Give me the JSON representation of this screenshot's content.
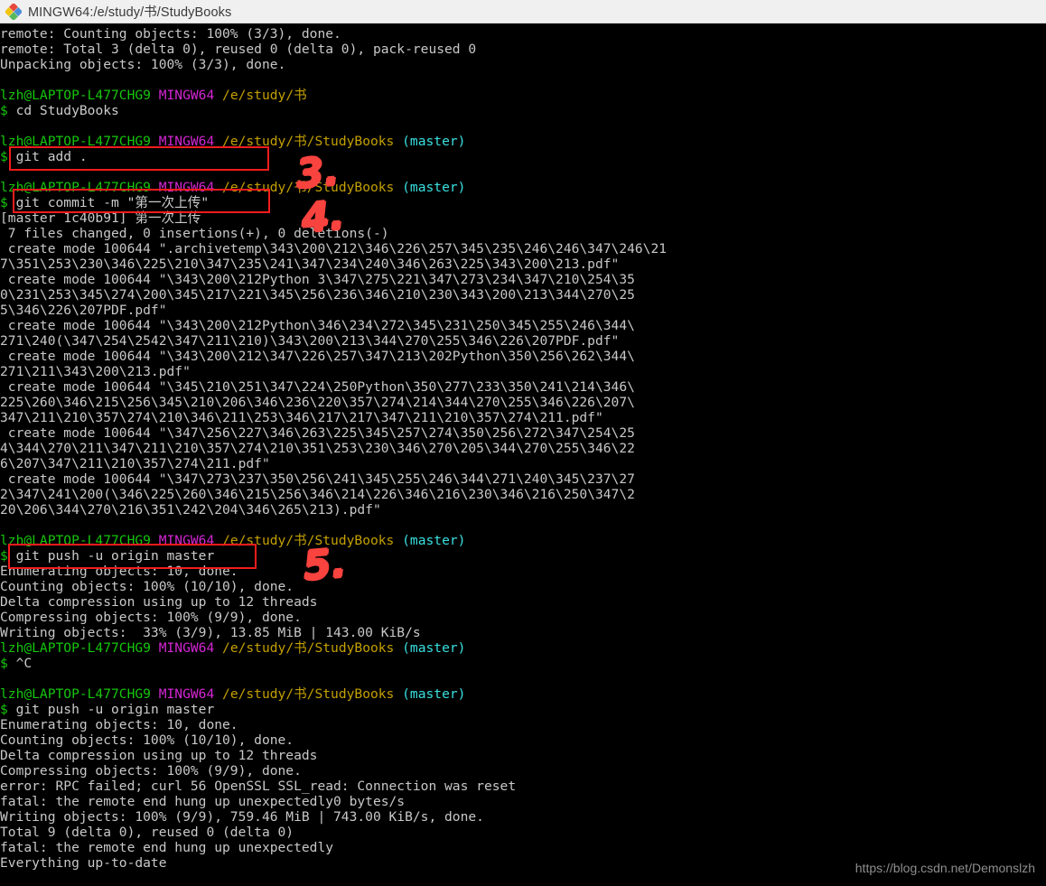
{
  "window": {
    "title": "MINGW64:/e/study/书/StudyBooks",
    "icon": "mingw-diamond-icon"
  },
  "watermark": "https://blog.csdn.net/Demonslzh",
  "colors": {
    "background": "#000000",
    "foreground": "#cccccc",
    "user_host": "#16c60c",
    "shell_name": "#d426d4",
    "path": "#c4a000",
    "branch": "#3ae0e0",
    "annotation_red": "#f41c1c",
    "scribble_red": "#f9433f",
    "titlebar_bg": "#f0f0f0"
  },
  "prompt": {
    "user_host": "lzh@LAPTOP-L477CHG9",
    "shell": "MINGW64",
    "path_book": "/e/study/书",
    "path_repo": "/e/study/书/StudyBooks",
    "branch": "(master)",
    "symbol": "$"
  },
  "annotations": [
    {
      "label": "3.",
      "target": "git add ."
    },
    {
      "label": "4.",
      "target": "git commit -m \"第一次上传\""
    },
    {
      "label": "5.",
      "target": "git push -u origin master"
    }
  ],
  "terminal_lines": [
    {
      "type": "out",
      "text": "remote: Counting objects: 100% (3/3), done."
    },
    {
      "type": "out",
      "text": "remote: Total 3 (delta 0), reused 0 (delta 0), pack-reused 0"
    },
    {
      "type": "out",
      "text": "Unpacking objects: 100% (3/3), done."
    },
    {
      "type": "blank",
      "text": ""
    },
    {
      "type": "prompt",
      "path": "/e/study/书",
      "branch": ""
    },
    {
      "type": "cmd",
      "text": "cd StudyBooks"
    },
    {
      "type": "blank",
      "text": ""
    },
    {
      "type": "prompt",
      "path": "/e/study/书/StudyBooks",
      "branch": "(master)"
    },
    {
      "type": "cmd",
      "text": "git add ."
    },
    {
      "type": "blank",
      "text": ""
    },
    {
      "type": "prompt",
      "path": "/e/study/书/StudyBooks",
      "branch": "(master)"
    },
    {
      "type": "cmd",
      "text": "git commit -m \"第一次上传\""
    },
    {
      "type": "out",
      "text": "[master 1c40b91] 第一次上传"
    },
    {
      "type": "out",
      "text": " 7 files changed, 0 insertions(+), 0 deletions(-)"
    },
    {
      "type": "out",
      "text": " create mode 100644 \".archivetemp\\343\\200\\212\\346\\226\\257\\345\\235\\246\\246\\347\\246\\21"
    },
    {
      "type": "out",
      "text": "7\\351\\253\\230\\346\\225\\210\\347\\235\\241\\347\\234\\240\\346\\263\\225\\343\\200\\213.pdf\""
    },
    {
      "type": "out",
      "text": " create mode 100644 \"\\343\\200\\212Python 3\\347\\275\\221\\347\\273\\234\\347\\210\\254\\35"
    },
    {
      "type": "out",
      "text": "0\\231\\253\\345\\274\\200\\345\\217\\221\\345\\256\\236\\346\\210\\230\\343\\200\\213\\344\\270\\25"
    },
    {
      "type": "out",
      "text": "5\\346\\226\\207PDF.pdf\""
    },
    {
      "type": "out",
      "text": " create mode 100644 \"\\343\\200\\212Python\\346\\234\\272\\345\\231\\250\\345\\255\\246\\344\\"
    },
    {
      "type": "out",
      "text": "271\\240(\\347\\254\\2542\\347\\211\\210)\\343\\200\\213\\344\\270\\255\\346\\226\\207PDF.pdf\""
    },
    {
      "type": "out",
      "text": " create mode 100644 \"\\343\\200\\212\\347\\226\\257\\347\\213\\202Python\\350\\256\\262\\344\\"
    },
    {
      "type": "out",
      "text": "271\\211\\343\\200\\213.pdf\""
    },
    {
      "type": "out",
      "text": " create mode 100644 \"\\345\\210\\251\\347\\224\\250Python\\350\\277\\233\\350\\241\\214\\346\\"
    },
    {
      "type": "out",
      "text": "225\\260\\346\\215\\256\\345\\210\\206\\346\\236\\220\\357\\274\\214\\344\\270\\255\\346\\226\\207\\"
    },
    {
      "type": "out",
      "text": "347\\211\\210\\357\\274\\210\\346\\211\\253\\346\\217\\217\\347\\211\\210\\357\\274\\211.pdf\""
    },
    {
      "type": "out",
      "text": " create mode 100644 \"\\347\\256\\227\\346\\263\\225\\345\\257\\274\\350\\256\\272\\347\\254\\25"
    },
    {
      "type": "out",
      "text": "4\\344\\270\\211\\347\\211\\210\\357\\274\\210\\351\\253\\230\\346\\270\\205\\344\\270\\255\\346\\22"
    },
    {
      "type": "out",
      "text": "6\\207\\347\\211\\210\\357\\274\\211.pdf\""
    },
    {
      "type": "out",
      "text": " create mode 100644 \"\\347\\273\\237\\350\\256\\241\\345\\255\\246\\344\\271\\240\\345\\237\\27"
    },
    {
      "type": "out",
      "text": "2\\347\\241\\200(\\346\\225\\260\\346\\215\\256\\346\\214\\226\\346\\216\\230\\346\\216\\250\\347\\2"
    },
    {
      "type": "out",
      "text": "20\\206\\344\\270\\216\\351\\242\\204\\346\\265\\213).pdf\""
    },
    {
      "type": "blank",
      "text": ""
    },
    {
      "type": "prompt",
      "path": "/e/study/书/StudyBooks",
      "branch": "(master)"
    },
    {
      "type": "cmd",
      "text": "git push -u origin master"
    },
    {
      "type": "out",
      "text": "Enumerating objects: 10, done."
    },
    {
      "type": "out",
      "text": "Counting objects: 100% (10/10), done."
    },
    {
      "type": "out",
      "text": "Delta compression using up to 12 threads"
    },
    {
      "type": "out",
      "text": "Compressing objects: 100% (9/9), done."
    },
    {
      "type": "out",
      "text": "Writing objects:  33% (3/9), 13.85 MiB | 143.00 KiB/s"
    },
    {
      "type": "prompt",
      "path": "/e/study/书/StudyBooks",
      "branch": "(master)"
    },
    {
      "type": "cmd",
      "text": "^C"
    },
    {
      "type": "blank",
      "text": ""
    },
    {
      "type": "prompt",
      "path": "/e/study/书/StudyBooks",
      "branch": "(master)"
    },
    {
      "type": "cmd",
      "text": "git push -u origin master"
    },
    {
      "type": "out",
      "text": "Enumerating objects: 10, done."
    },
    {
      "type": "out",
      "text": "Counting objects: 100% (10/10), done."
    },
    {
      "type": "out",
      "text": "Delta compression using up to 12 threads"
    },
    {
      "type": "out",
      "text": "Compressing objects: 100% (9/9), done."
    },
    {
      "type": "out",
      "text": "error: RPC failed; curl 56 OpenSSL SSL_read: Connection was reset"
    },
    {
      "type": "out",
      "text": "fatal: the remote end hung up unexpectedly0 bytes/s"
    },
    {
      "type": "out",
      "text": "Writing objects: 100% (9/9), 759.46 MiB | 743.00 KiB/s, done."
    },
    {
      "type": "out",
      "text": "Total 9 (delta 0), reused 0 (delta 0)"
    },
    {
      "type": "out",
      "text": "fatal: the remote end hung up unexpectedly"
    },
    {
      "type": "out",
      "text": "Everything up-to-date"
    }
  ]
}
